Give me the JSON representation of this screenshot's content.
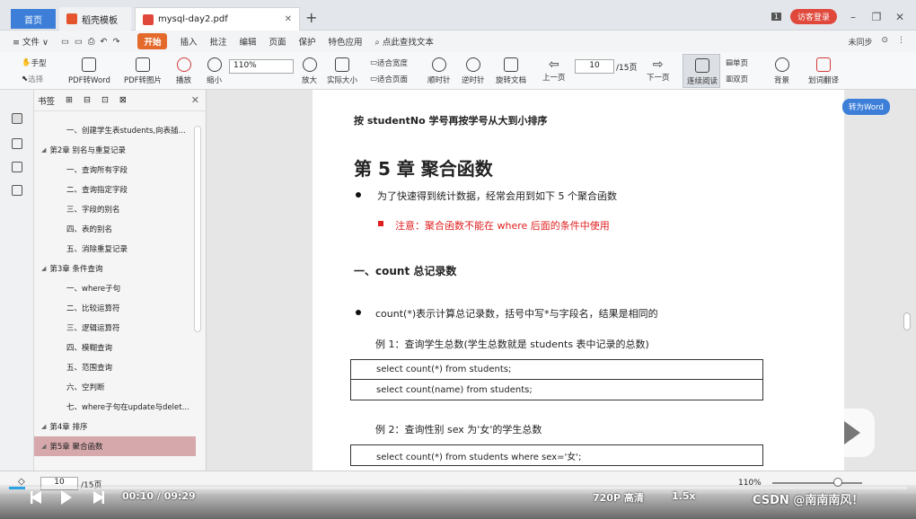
{
  "tabs": {
    "home": "首页",
    "templates": "稻壳模板",
    "pdf": "mysql-day2.pdf"
  },
  "titlebar": {
    "guest_login": "访客登录",
    "badge": "1"
  },
  "menu": {
    "file": "≡ 文件 ∨",
    "start": "开始",
    "items": [
      "插入",
      "批注",
      "编辑",
      "页面",
      "保护",
      "特色应用"
    ],
    "search": "点此查找文本",
    "right_items": [
      "未同步",
      "⊙",
      "⋮"
    ]
  },
  "toolbar": {
    "hand": "手型",
    "select": "选择",
    "pdf_to_word": "PDF转Word",
    "pdf_to_image": "PDF转图片",
    "play": "播放",
    "zoom_out": "缩小",
    "zoom_value": "110%",
    "zoom_in": "放大",
    "actual_size": "实际大小",
    "fit_width": "适合宽度",
    "fit_page": "适合页面",
    "rotate_cw": "顺时针",
    "rotate_ccw": "逆时针",
    "rotate_doc": "旋转文档",
    "prev_page": "上一页",
    "page_value": "10",
    "page_total": "/15页",
    "next_page": "下一页",
    "continuous": "连续阅读",
    "single_page": "单页",
    "double_page": "双页",
    "background": "背景",
    "translate": "划词翻译"
  },
  "bookmarks": {
    "title": "书签",
    "items": [
      {
        "label": "一、创建学生表students,向表插...",
        "level": "sec"
      },
      {
        "label": "第2章 别名与重复记录",
        "level": "ch"
      },
      {
        "label": "一、查询所有字段",
        "level": "sec"
      },
      {
        "label": "二、查询指定字段",
        "level": "sec"
      },
      {
        "label": "三、字段的别名",
        "level": "sec"
      },
      {
        "label": "四、表的别名",
        "level": "sec"
      },
      {
        "label": "五、消除重复记录",
        "level": "sec"
      },
      {
        "label": "第3章 条件查询",
        "level": "ch"
      },
      {
        "label": "一、where子句",
        "level": "sec"
      },
      {
        "label": "二、比较运算符",
        "level": "sec"
      },
      {
        "label": "三、逻辑运算符",
        "level": "sec"
      },
      {
        "label": "四、模糊查询",
        "level": "sec"
      },
      {
        "label": "五、范围查询",
        "level": "sec"
      },
      {
        "label": "六、空判断",
        "level": "sec"
      },
      {
        "label": "七、where子句在update与delet...",
        "level": "sec"
      },
      {
        "label": "第4章 排序",
        "level": "ch"
      },
      {
        "label": "第5章 聚合函数",
        "level": "ch",
        "active": true
      }
    ]
  },
  "document": {
    "sort_line": "按 studentNo 学号再按学号从大到小排序",
    "chapter": "第 5 章  聚合函数",
    "bullet1": "为了快速得到统计数据，经常会用到如下 5 个聚合函数",
    "note": "注意：聚合函数不能在  where  后面的条件中使用",
    "section1": "一、count 总记录数",
    "bullet2": "count(*)表示计算总记录数，括号中写*与字段名，结果是相同的",
    "example1": "例 1：查询学生总数(学生总数就是 students 表中记录的总数)",
    "code1": [
      "select count(*) from students;",
      "select count(name) from students;"
    ],
    "example2": "例 2：查询性别 sex 为'女'的学生总数",
    "code2": [
      "select count(*) from students where sex='女';"
    ]
  },
  "to_word": "转为Word",
  "statusbar": {
    "page_value": "10",
    "page_total": "/15页",
    "zoom": "110%"
  },
  "video": {
    "time": "00:10 / 09:29",
    "quality": "720P 高清",
    "speed": "1.5x",
    "watermark": "CSDN @南南南风！",
    "progress_fraction": 0.018
  },
  "colors": {
    "accent": "#3d7fd8",
    "start": "#e46a2c",
    "note_red": "#e01e1e",
    "active_bookmark": "#d6a8ac"
  }
}
